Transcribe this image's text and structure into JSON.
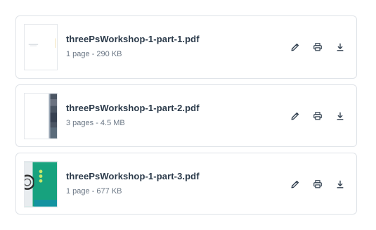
{
  "files": [
    {
      "name": "threePsWorkshop-1-part-1.pdf",
      "meta": "1 page - 290 KB"
    },
    {
      "name": "threePsWorkshop-1-part-2.pdf",
      "meta": "3 pages - 4.5 MB"
    },
    {
      "name": "threePsWorkshop-1-part-3.pdf",
      "meta": "1 page - 677 KB"
    }
  ],
  "icons": {
    "edit": "pencil-icon",
    "print": "printer-icon",
    "download": "download-icon"
  },
  "colors": {
    "border": "#dfe3e8",
    "title": "#2b3a4a",
    "meta": "#6b7785",
    "icon": "#2b3a4a",
    "thumb_accent_teal": "#1aa37f"
  }
}
